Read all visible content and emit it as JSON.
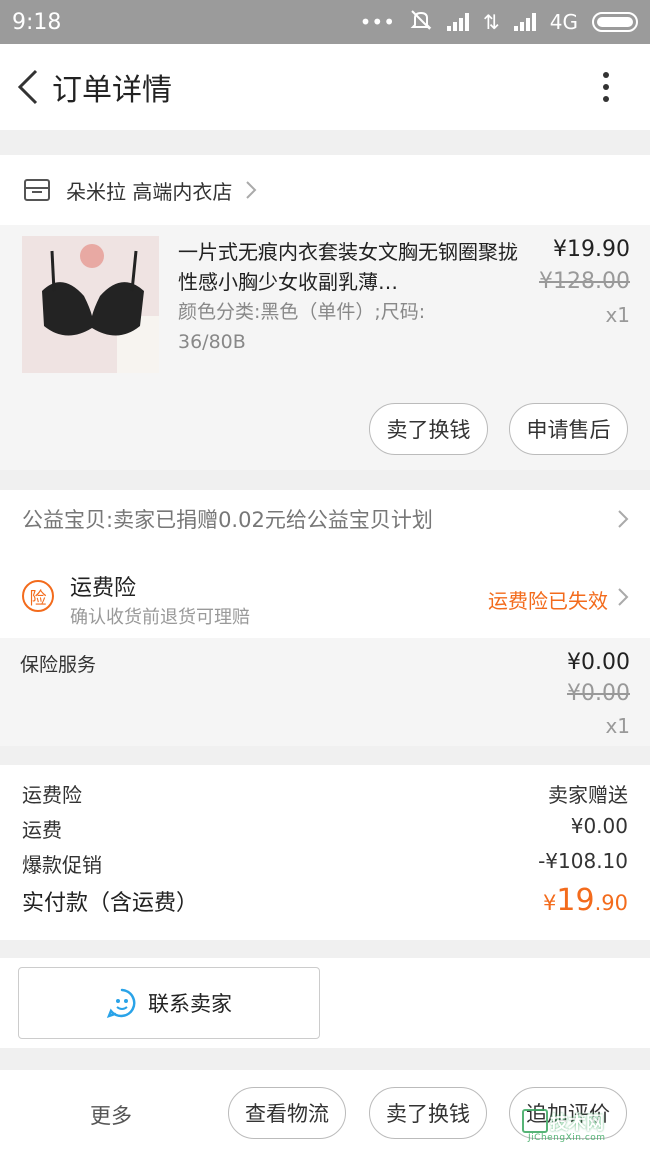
{
  "status_bar": {
    "time": "9:18",
    "network": "4G"
  },
  "header": {
    "title": "订单详情"
  },
  "shop": {
    "name": "朵米拉 高端内衣店"
  },
  "product": {
    "name": "一片式无痕内衣套装女文胸无钢圈聚拢性感小胸少女收副乳薄…",
    "spec": "颜色分类:黑色（单件）;尺码: 36/80B",
    "price": "¥19.90",
    "original_price": "¥128.00",
    "quantity": "x1",
    "actions": {
      "sell": "卖了换钱",
      "after_sale": "申请售后"
    }
  },
  "charity": {
    "text": "公益宝贝:卖家已捐赠0.02元给公益宝贝计划"
  },
  "shipping_insurance": {
    "icon_char": "险",
    "name": "运费险",
    "desc": "确认收货前退货可理赔",
    "status": "运费险已失效"
  },
  "insurance_service": {
    "name": "保险服务",
    "price": "¥0.00",
    "original_price": "¥0.00",
    "quantity": "x1"
  },
  "summary": {
    "rows": [
      {
        "label": "运费险",
        "value": "卖家赠送"
      },
      {
        "label": "运费",
        "value": "¥0.00"
      },
      {
        "label": "爆款促销",
        "value": "-¥108.10"
      }
    ],
    "total_label": "实付款（含运费）",
    "total_currency": "¥",
    "total_int": "19",
    "total_dec": ".90"
  },
  "contact": {
    "label": "联系卖家"
  },
  "bottom_bar": {
    "more": "更多",
    "buttons": [
      "查看物流",
      "卖了换钱",
      "追加评价"
    ]
  },
  "watermark": {
    "text": "技术网",
    "sub": "JiChengXin.com"
  },
  "colors": {
    "accent": "#f36b1c",
    "contact_icon": "#2aa3e8",
    "watermark": "#3aa860"
  }
}
